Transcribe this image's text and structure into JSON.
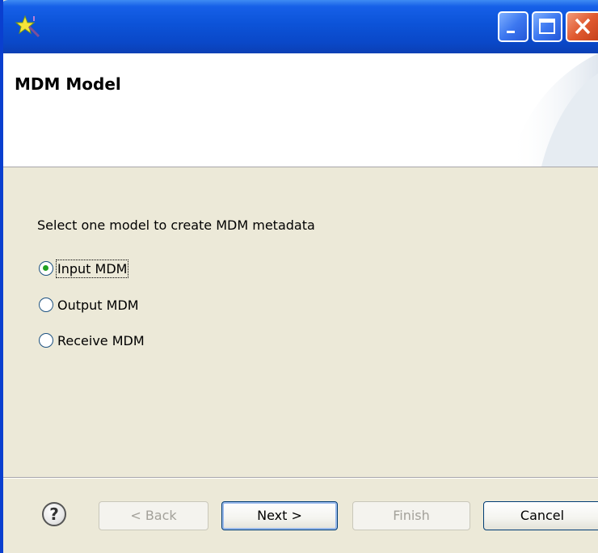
{
  "window": {
    "app_icon": "wizard-star-icon",
    "controls": {
      "minimize": "minimize-icon",
      "maximize": "maximize-icon",
      "close": "close-icon"
    }
  },
  "header": {
    "title": "MDM Model"
  },
  "content": {
    "prompt": "Select one model to create MDM metadata",
    "options": [
      {
        "label": "Input MDM",
        "selected": true
      },
      {
        "label": "Output MDM",
        "selected": false
      },
      {
        "label": "Receive MDM",
        "selected": false
      }
    ]
  },
  "footer": {
    "help_icon": "help-icon",
    "help_glyph": "?",
    "back_label": "< Back",
    "next_label": "Next >",
    "finish_label": "Finish",
    "cancel_label": "Cancel",
    "back_enabled": false,
    "finish_enabled": false
  },
  "colors": {
    "titlebar": "#0a48c8",
    "dialog_bg": "#ece9d8",
    "radio_dot": "#21a121",
    "close_button": "#e05a30"
  }
}
